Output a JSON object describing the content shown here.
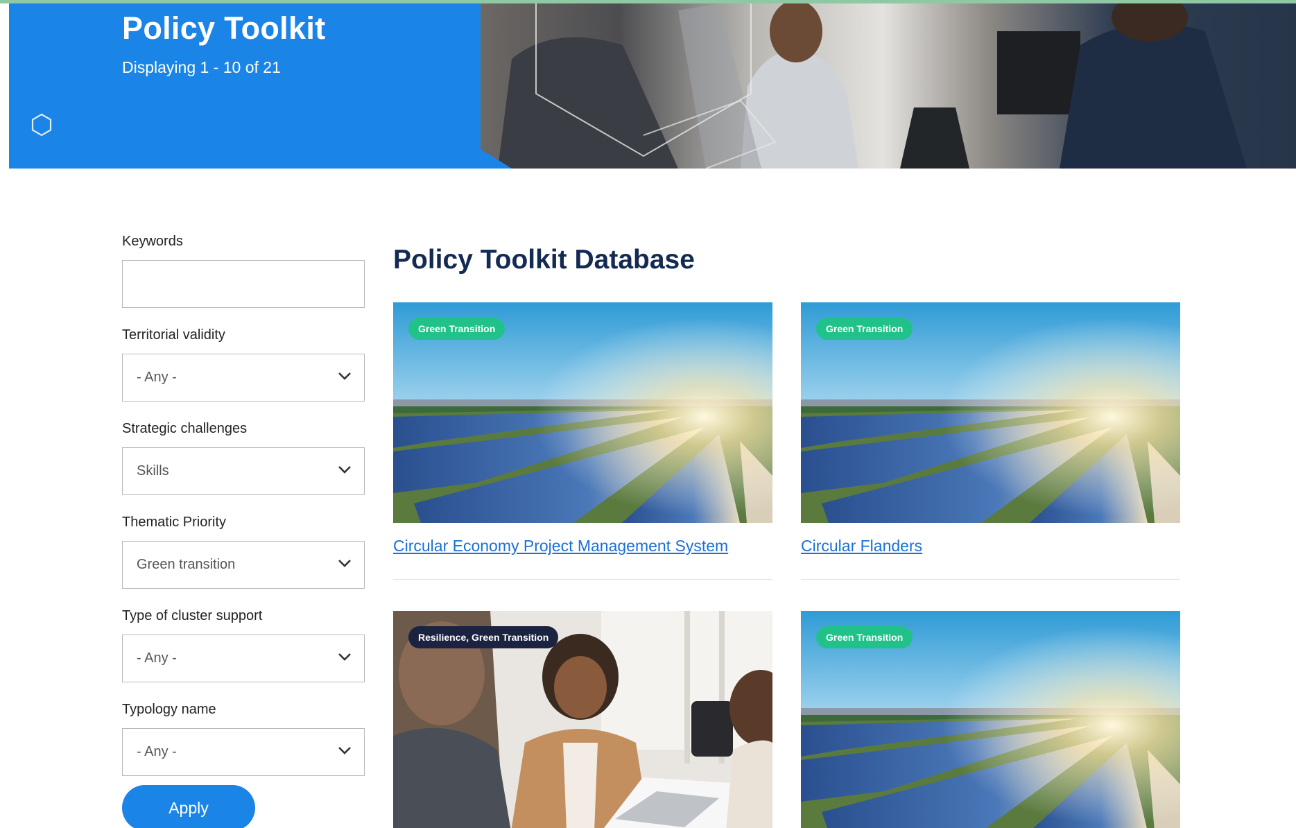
{
  "hero": {
    "title": "Policy Toolkit",
    "subtitle": "Displaying 1 - 10 of 21"
  },
  "filters": {
    "keywords": {
      "label": "Keywords",
      "value": ""
    },
    "territorial_validity": {
      "label": "Territorial validity",
      "value": "- Any -"
    },
    "strategic_challenges": {
      "label": "Strategic challenges",
      "value": "Skills"
    },
    "thematic_priority": {
      "label": "Thematic Priority",
      "value": "Green transition"
    },
    "cluster_support": {
      "label": "Type of cluster support",
      "value": "- Any -"
    },
    "typology_name": {
      "label": "Typology name",
      "value": "- Any -"
    },
    "apply_label": "Apply"
  },
  "main": {
    "title": "Policy Toolkit Database",
    "cards": [
      {
        "tag": "Green Transition",
        "title": "Circular Economy Project Management System",
        "image": "solar-panels-image"
      },
      {
        "tag": "Green Transition",
        "title": "Circular Flanders",
        "image": "solar-panels-image"
      },
      {
        "tag": "Resilience, Green Transition",
        "title": "",
        "image": "business-meeting-image"
      },
      {
        "tag": "Green Transition",
        "title": "",
        "image": "solar-panels-image"
      }
    ]
  },
  "colors": {
    "brand_blue": "#1a85e6",
    "heading_navy": "#132a52",
    "link_blue": "#1a6fd6",
    "tag_green": "#20c28a",
    "tag_dark": "#1c2340"
  }
}
